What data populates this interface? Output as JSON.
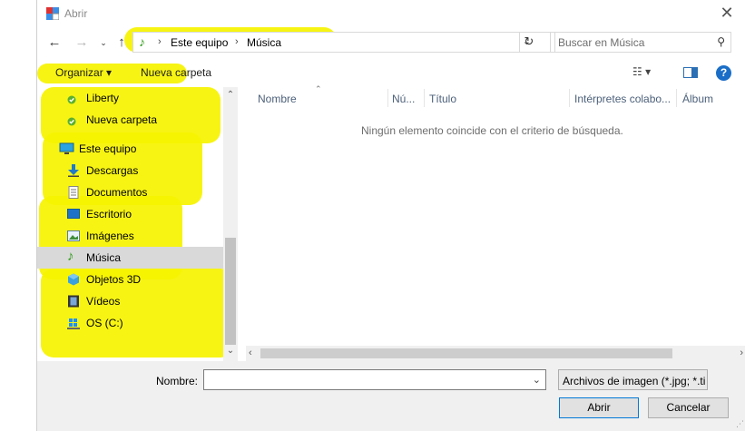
{
  "window": {
    "title": "Abrir"
  },
  "address": {
    "crumbs": [
      "Este equipo",
      "Música"
    ]
  },
  "search": {
    "placeholder": "Buscar en Música"
  },
  "toolbar": {
    "organize": "Organizar ▾",
    "new_folder": "Nueva carpeta"
  },
  "nav": {
    "items": [
      {
        "label": "Liberty",
        "icon": "folder-check-icon"
      },
      {
        "label": "Nueva carpeta",
        "icon": "folder-check-icon"
      },
      {
        "label": "Este equipo",
        "icon": "computer-icon"
      },
      {
        "label": "Descargas",
        "icon": "download-icon"
      },
      {
        "label": "Documentos",
        "icon": "document-icon"
      },
      {
        "label": "Escritorio",
        "icon": "desktop-icon"
      },
      {
        "label": "Imágenes",
        "icon": "pictures-icon"
      },
      {
        "label": "Música",
        "icon": "music-icon",
        "selected": true
      },
      {
        "label": "Objetos 3D",
        "icon": "cube-icon"
      },
      {
        "label": "Vídeos",
        "icon": "video-icon"
      },
      {
        "label": "OS (C:)",
        "icon": "drive-icon"
      }
    ]
  },
  "columns": [
    "Nombre",
    "Nú...",
    "Título",
    "Intérpretes colabo...",
    "Álbum"
  ],
  "empty_message": "Ningún elemento coincide con el criterio de búsqueda.",
  "footer": {
    "name_label": "Nombre:",
    "name_value": "",
    "filetype": "Archivos de imagen  (*.jpg; *.ti",
    "open_label": "Abrir",
    "cancel_label": "Cancelar"
  },
  "colors": {
    "highlight": "#f6f300",
    "accent": "#0078d7",
    "music": "#2e9a17"
  }
}
